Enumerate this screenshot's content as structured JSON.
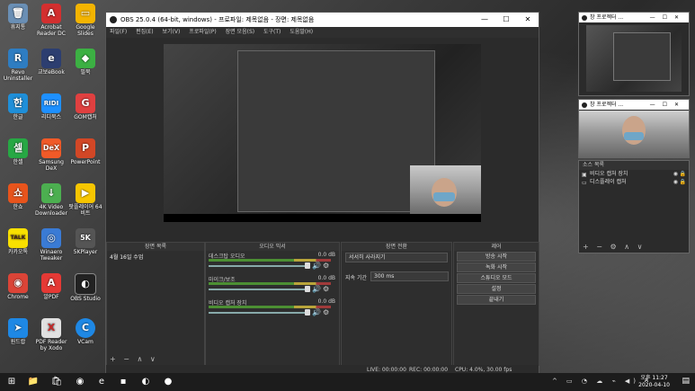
{
  "desktop": {
    "icons": [
      {
        "label": "휴지통",
        "glyph": "🗑",
        "color": "#6a8fb5"
      },
      {
        "label": "Acrobat Reader DC",
        "glyph": "A",
        "color": "#d32f2f"
      },
      {
        "label": "Google Slides",
        "glyph": "▭",
        "color": "#f4b400"
      },
      {
        "label": "Revo Uninstaller",
        "glyph": "R",
        "color": "#2e7dc2"
      },
      {
        "label": "교보eBook",
        "glyph": "e",
        "color": "#2c3e70"
      },
      {
        "label": "필북",
        "glyph": "◆",
        "color": "#3cb043"
      },
      {
        "label": "한글",
        "glyph": "한",
        "color": "#1f8fd9"
      },
      {
        "label": "리디북스",
        "glyph": "RIDI",
        "color": "#1e90ff"
      },
      {
        "label": "GOM캡처",
        "glyph": "G",
        "color": "#e04040"
      },
      {
        "label": "한셀",
        "glyph": "셀",
        "color": "#27a844"
      },
      {
        "label": "Samsung DeX",
        "glyph": "DeX",
        "color": "#f05a28"
      },
      {
        "label": "PowerPoint",
        "glyph": "P",
        "color": "#d24726"
      },
      {
        "label": "한쇼",
        "glyph": "쇼",
        "color": "#e8541c"
      },
      {
        "label": "4K Video Downloader",
        "glyph": "↓",
        "color": "#4caf50"
      },
      {
        "label": "팟플레이어 64 비트",
        "glyph": "▶",
        "color": "#f7c600"
      },
      {
        "label": "카카오톡",
        "glyph": "TALK",
        "color": "#f9e000"
      },
      {
        "label": "Winaero Tweaker",
        "glyph": "◎",
        "color": "#3a7bd5"
      },
      {
        "label": "5KPlayer",
        "glyph": "5K",
        "color": "#555"
      },
      {
        "label": "Chrome",
        "glyph": "◉",
        "color": "#db4437"
      },
      {
        "label": "알PDF",
        "glyph": "A",
        "color": "#e53935"
      },
      {
        "label": "OBS Studio",
        "glyph": "◐",
        "color": "#222"
      },
      {
        "label": "원드랍",
        "glyph": "➤",
        "color": "#1e88e5"
      },
      {
        "label": "PDF Reader by Xodo",
        "glyph": "X",
        "color": "#e0e0e0"
      },
      {
        "label": "VCam",
        "glyph": "C",
        "color": "#1e88e5"
      }
    ]
  },
  "obs": {
    "title": "OBS 25.0.4 (64-bit, windows) - 프로파일: 제목없음 - 장면: 제목없음",
    "window_buttons": [
      "—",
      "☐",
      "✕"
    ],
    "menu": [
      "파일(F)",
      "편집(E)",
      "보기(V)",
      "프로파일(P)",
      "장면 모음(S)",
      "도구(T)",
      "도움말(H)"
    ],
    "scenes_title": "장면 목록",
    "scenes": [
      "4월 16일 수업"
    ],
    "scenes_footer": "+ − ∧ ∨",
    "mixer_title": "오디오 믹서",
    "mixer": [
      {
        "name": "데스크탑 오디오",
        "db": "0.0 dB"
      },
      {
        "name": "마이크/보조",
        "db": "0.0 dB"
      },
      {
        "name": "비디오 캡처 장치",
        "db": "0.0 dB"
      }
    ],
    "transition_title": "장면 전환",
    "transition_selected": "서서히 사라지기",
    "duration_label": "지속 기간",
    "duration_value": "300 ms",
    "controls_title": "제어",
    "controls": [
      "방송 시작",
      "녹화 시작",
      "스튜디오 모드",
      "설정",
      "끝내기"
    ],
    "status": {
      "live": "LIVE: 00:00:00",
      "rec": "REC: 00:00:00",
      "cpu": "CPU: 4.0%, 30.00 fps"
    }
  },
  "projectors": [
    {
      "title": "창 프로젝터 ..."
    },
    {
      "title": "창 프로젝터 ..."
    }
  ],
  "sources": {
    "title": "소스 목록",
    "items": [
      {
        "name": "비디오 캡처 장치",
        "icon": "▣"
      },
      {
        "name": "디스플레이 캡처",
        "icon": "▭"
      }
    ],
    "footer": "+ − ⚙ ∧ ∨"
  },
  "taskbar": {
    "time": "오후 11:27",
    "date": "2020-04-10",
    "lang": "A"
  }
}
